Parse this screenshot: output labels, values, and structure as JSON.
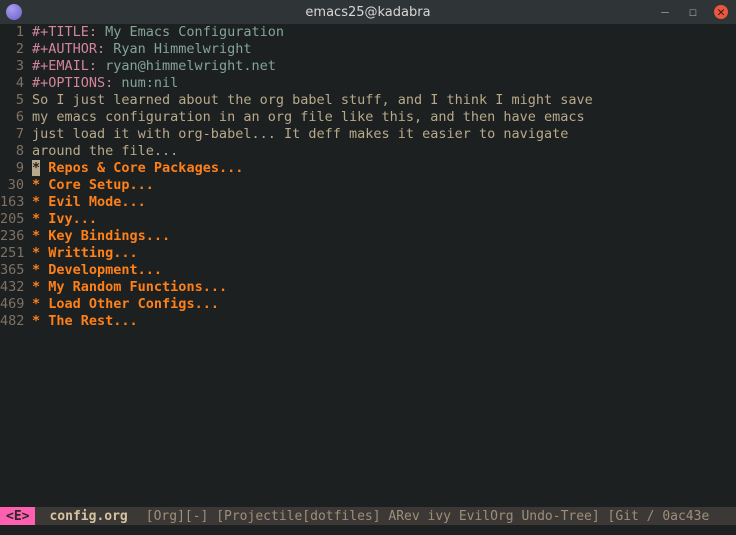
{
  "window": {
    "title": "emacs25@kadabra"
  },
  "lines": [
    {
      "num": "1",
      "key": "#+TITLE: ",
      "val": "My Emacs Configuration"
    },
    {
      "num": "2",
      "key": "#+AUTHOR: ",
      "val": "Ryan Himmelwright"
    },
    {
      "num": "3",
      "key": "#+EMAIL: ",
      "val": "ryan@himmelwright.net"
    },
    {
      "num": "4",
      "key": "#+OPTIONS: ",
      "val": "num:nil"
    }
  ],
  "body": {
    "l5": "So I just learned about the org babel stuff, and I think I might save",
    "l6": "my emacs configuration in an org file like this, and then have emacs",
    "l7": "just load it with org-babel... It deff makes it easier to navigate",
    "l8": "around the file..."
  },
  "headings": [
    {
      "num": "9",
      "pre": "*",
      "text": " Repos & Core Packages...",
      "cursor": true
    },
    {
      "num": "30",
      "pre": "*",
      "text": " Core Setup..."
    },
    {
      "num": "163",
      "pre": "*",
      "text": " Evil Mode..."
    },
    {
      "num": "205",
      "pre": "*",
      "text": " Ivy..."
    },
    {
      "num": "236",
      "pre": "*",
      "text": " Key Bindings..."
    },
    {
      "num": "251",
      "pre": "*",
      "text": " Writting..."
    },
    {
      "num": "365",
      "pre": "*",
      "text": " Development..."
    },
    {
      "num": "432",
      "pre": "*",
      "text": " My Random Functions..."
    },
    {
      "num": "469",
      "pre": "*",
      "text": " Load Other Configs..."
    },
    {
      "num": "482",
      "pre": "*",
      "text": " The Rest..."
    }
  ],
  "modeline": {
    "evil": "<E>",
    "buffer": "config.org",
    "rest": "[Org][-] [Projectile[dotfiles] ARev ivy EvilOrg Undo-Tree] [Git / 0ac43e"
  }
}
